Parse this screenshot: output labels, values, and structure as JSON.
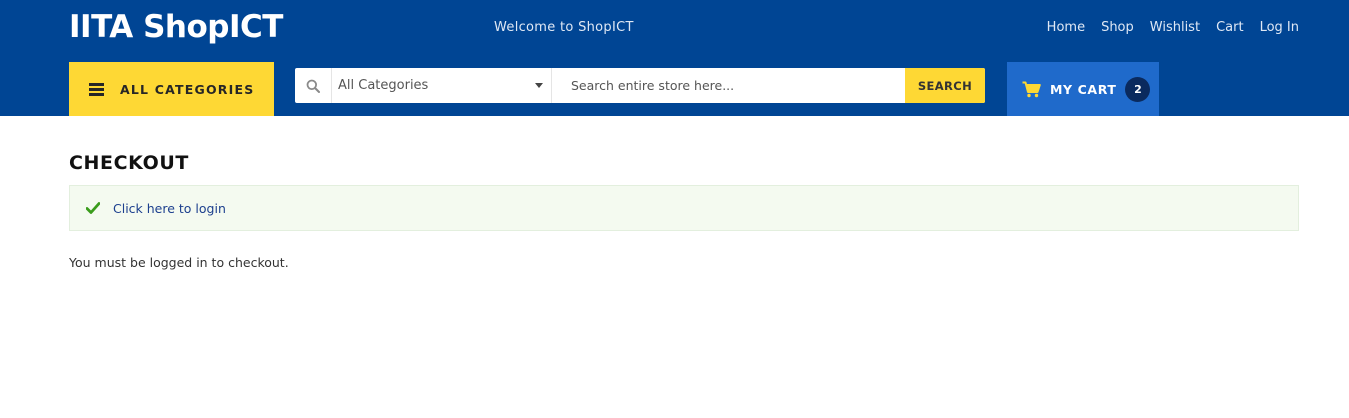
{
  "header": {
    "logo": "IITA ShopICT",
    "welcome": "Welcome to ShopICT",
    "nav": [
      {
        "label": "Home"
      },
      {
        "label": "Shop"
      },
      {
        "label": "Wishlist"
      },
      {
        "label": "Cart"
      },
      {
        "label": "Log In"
      }
    ],
    "all_categories_label": "ALL CATEGORIES",
    "search": {
      "category_selected": "All Categories",
      "placeholder": "Search entire store here...",
      "button_label": "SEARCH"
    },
    "cart": {
      "label": "MY CART",
      "count": "2"
    }
  },
  "main": {
    "title": "CHECKOUT",
    "notice_link": "Click here to login",
    "login_message": "You must be logged in to checkout."
  },
  "colors": {
    "header_bg": "#004594",
    "accent_yellow": "#fed834",
    "cart_bg": "#1f6acb",
    "notice_bg": "#f4faf0",
    "success_green": "#3a9c1c"
  },
  "icons": {
    "menu": "hamburger-icon",
    "search": "search-icon",
    "select_caret": "caret-down-icon",
    "cart": "cart-icon",
    "notice": "check-icon"
  }
}
